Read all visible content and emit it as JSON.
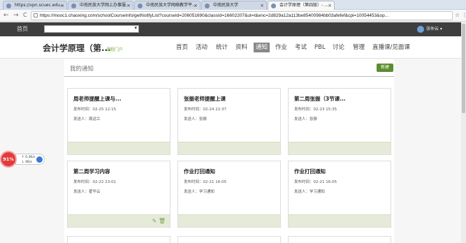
{
  "browser": {
    "tabs": [
      {
        "label": "https://vpn.scuec.edu...",
        "active": false
      },
      {
        "label": "中南民族大学网上办事服...",
        "active": false
      },
      {
        "label": "中南民族大学网络教学平...",
        "active": false
      },
      {
        "label": "中南民族大学",
        "active": false
      },
      {
        "label": "会计学原理（第四版）- ...",
        "active": true
      }
    ],
    "url": "https://mooc1.chaoxing.com/schoolCourseInfo/getNotifyList?courseId=206051690&classId=16602207&ut=t&enc=2d829a12a113be85400984bb03afefef&cpi=10054453&op...",
    "back_label": "←",
    "forward_label": "→",
    "reload_label": "C",
    "star_label": "☆",
    "menu_label": "⋮"
  },
  "topnav": {
    "home": "首页",
    "search_dropdown": "▾",
    "user_name": "张仲云 ▾"
  },
  "course": {
    "title": "会计学原理（第...",
    "portal_link": "课程门户",
    "menu": [
      "首页",
      "活动",
      "统计",
      "资料",
      "通知",
      "作业",
      "考试",
      "PBL",
      "讨论",
      "管理",
      "直播课/见面课"
    ],
    "active_menu": "通知"
  },
  "notices": {
    "heading": "我的通知",
    "new_button": "新建",
    "cards": [
      {
        "title": "周老师提醒上课与...",
        "time": "发布时间：02-25 12:15",
        "author": "发送人：周运兰",
        "has_actions": false
      },
      {
        "title": "张振老师提醒上课",
        "time": "发布时间：02-24 22:37",
        "author": "发送人：张振",
        "has_actions": false
      },
      {
        "title": "第二周张振（3节课...",
        "time": "发布时间：02-23 15:35",
        "author": "发送人：张振",
        "has_actions": false
      },
      {
        "title": "第二周学习内容",
        "time": "发布时间：02-22 23:01",
        "author": "发送人：翟华云",
        "has_actions": true
      },
      {
        "title": "作业打回通知",
        "time": "发布时间：02-21 16:05",
        "author": "发送人：学习通知",
        "has_actions": false
      },
      {
        "title": "作业打回通知",
        "time": "发布时间：02-21 16:05",
        "author": "发送人：学习通知",
        "has_actions": false
      }
    ],
    "edit_icon": "✎",
    "delete_icon": "🗑"
  },
  "widget": {
    "percent": "91%",
    "up": "↑ 0.3K/s",
    "down": "↓ 0K/s"
  },
  "colors": {
    "nav_bg": "#3e3e3e",
    "accent_green": "#5b8e2e",
    "card_footer": "#e5ebd8",
    "widget_red": "#e23b3b"
  }
}
